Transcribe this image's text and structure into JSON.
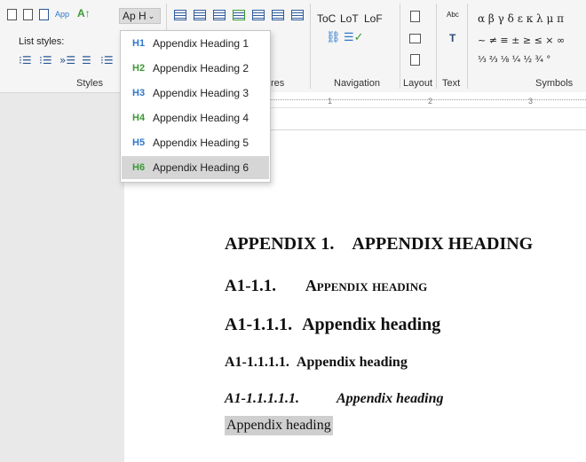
{
  "ribbon": {
    "apph_label": "Ap H",
    "app_label": "App",
    "list_styles_label": "List styles:",
    "groups": {
      "styles": "Styles",
      "structures_partial": "res",
      "navigation": "Navigation",
      "layout": "Layout",
      "text": "Text",
      "symbols": "Symbols"
    },
    "nav": {
      "toc": "ToC",
      "lot": "LoT",
      "lof": "LoF"
    },
    "abc_label": "Abc",
    "symbols_row1": "α β γ δ ε κ λ μ π",
    "symbols_row2": "~ ≠ ≡ ± ≥ ≤ × ∞",
    "symbols_row3": "⅓ ⅔ ⅛ ¼ ½ ¾ °"
  },
  "dropdown": {
    "items": [
      {
        "tag": "H1",
        "label": "Appendix Heading 1",
        "color": "#2e77c9"
      },
      {
        "tag": "H2",
        "label": "Appendix Heading 2",
        "color": "#3a9a33"
      },
      {
        "tag": "H3",
        "label": "Appendix Heading 3",
        "color": "#2e77c9"
      },
      {
        "tag": "H4",
        "label": "Appendix Heading 4",
        "color": "#3a9a33"
      },
      {
        "tag": "H5",
        "label": "Appendix Heading 5",
        "color": "#2e77c9"
      },
      {
        "tag": "H6",
        "label": "Appendix Heading 6",
        "color": "#3a9a33"
      }
    ],
    "selected_index": 5
  },
  "ruler": {
    "marks": [
      "1",
      "2",
      "3"
    ]
  },
  "document": {
    "h1": "APPENDIX 1. APPENDIX HEADING",
    "h2_num": "A1-1.1.",
    "h2_text": "Appendix heading",
    "h3_num": "A1-1.1.1.",
    "h3_text": "Appendix heading",
    "h4_num": "A1-1.1.1.1.",
    "h4_text": "Appendix heading",
    "h5_num": "A1-1.1.1.1.1.",
    "h5_text": "Appendix heading",
    "h6_text": "Appendix heading"
  }
}
